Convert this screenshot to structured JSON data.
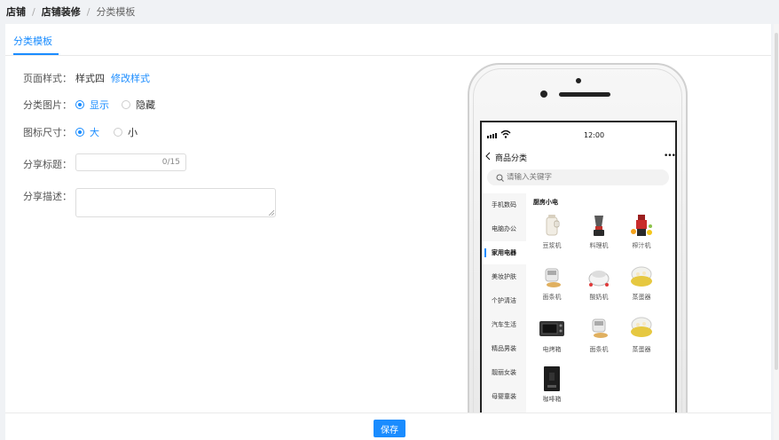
{
  "breadcrumb": {
    "items": [
      "店铺",
      "店铺装修",
      "分类模板"
    ],
    "separator": "/"
  },
  "tab": {
    "label": "分类模板"
  },
  "form": {
    "page_style": {
      "label": "页面样式：",
      "value": "样式四",
      "action": "修改样式"
    },
    "category_image": {
      "label": "分类图片：",
      "options": [
        "显示",
        "隐藏"
      ],
      "selected": "显示"
    },
    "icon_size": {
      "label": "图标尺寸：",
      "options": [
        "大",
        "小"
      ],
      "selected": "大"
    },
    "share_title": {
      "label": "分享标题：",
      "value": "",
      "counter": "0/15"
    },
    "share_desc": {
      "label": "分享描述：",
      "value": ""
    }
  },
  "footer": {
    "save_label": "保存"
  },
  "phone": {
    "time": "12:00",
    "nav_title": "商品分类",
    "more": "•••",
    "search_placeholder": "请输入关键字",
    "categories": [
      "手机数码",
      "电脑办公",
      "家用电器",
      "美妆护肤",
      "个护清洁",
      "汽车生活",
      "精品男装",
      "靓丽女装",
      "母婴童装"
    ],
    "active_category": "家用电器",
    "section_title": "厨房小电",
    "products": [
      "豆浆机",
      "料理机",
      "榨汁机",
      "面条机",
      "酸奶机",
      "蒸蛋器",
      "电烤箱",
      "面条机",
      "蒸蛋器",
      "咖啡箱"
    ]
  },
  "colors": {
    "accent": "#1a8cff",
    "background": "#f0f2f5"
  },
  "icons": [
    "back-icon",
    "search-icon",
    "more-icon",
    "signal-icon",
    "wifi-icon"
  ]
}
